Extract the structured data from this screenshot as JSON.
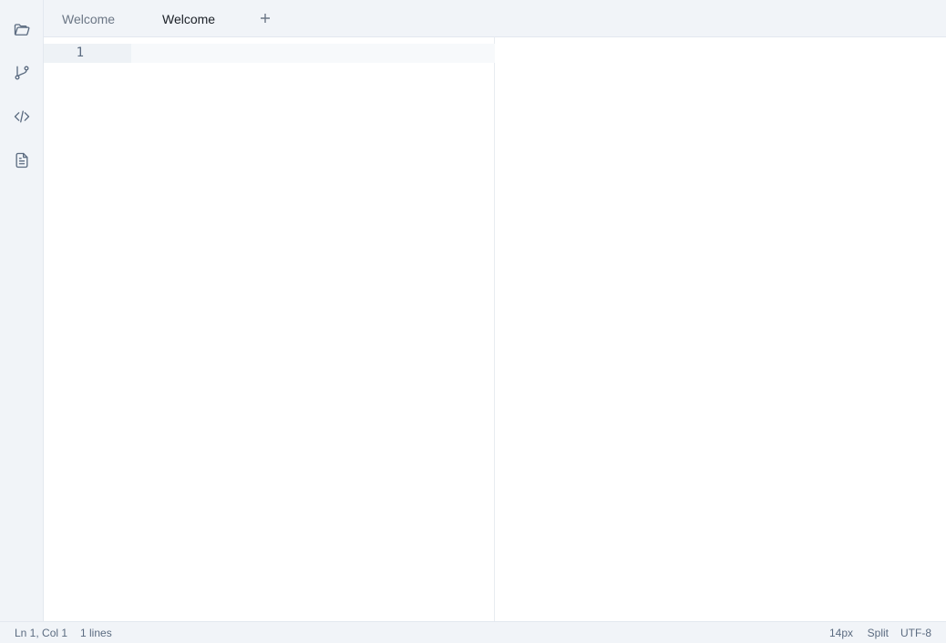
{
  "activity_bar": {
    "items": [
      {
        "icon": "folder-open-icon"
      },
      {
        "icon": "git-branch-icon"
      },
      {
        "icon": "code-icon"
      },
      {
        "icon": "document-icon"
      }
    ]
  },
  "tabs": [
    {
      "label": "Welcome",
      "active": false
    },
    {
      "label": "Welcome",
      "active": true
    }
  ],
  "new_tab_icon": "plus-icon",
  "editor": {
    "lines": [
      {
        "number": "1",
        "text": ""
      }
    ]
  },
  "status_bar": {
    "cursor_position": "Ln 1, Col 1",
    "line_count": "1 lines",
    "font_size": "14px",
    "layout_mode": "Split",
    "encoding": "UTF-8"
  },
  "colors": {
    "chrome_background": "#f1f4f8",
    "active_line_background": "#f7f9fb",
    "icon_color": "#5b6b80",
    "text_active": "#1a1f26",
    "text_inactive": "#6b7685"
  }
}
